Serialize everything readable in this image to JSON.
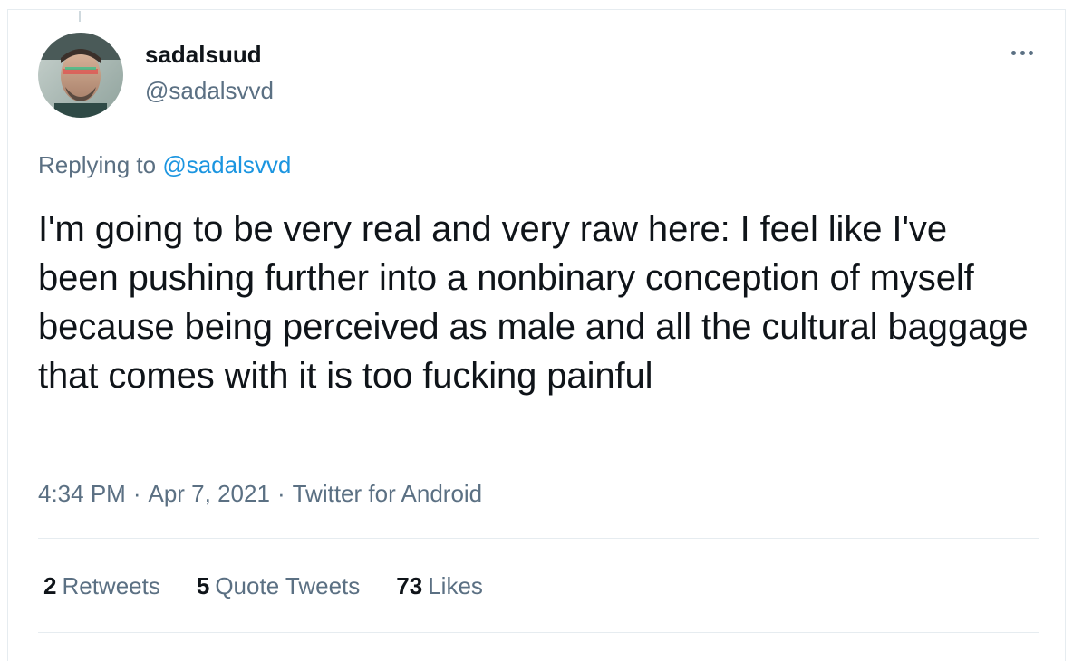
{
  "tweet": {
    "author": {
      "display_name": "sadalsuud",
      "handle": "@sadalsvvd"
    },
    "reply_context": {
      "prefix": "Replying to",
      "mention": "@sadalsvvd"
    },
    "text": "I'm going to be very real and very raw here: I feel like I've been pushing further into a nonbinary conception of myself because being perceived as male and all the cultural baggage that comes with it is too fucking painful",
    "time": "4:34 PM",
    "date": "Apr 7, 2021",
    "source": "Twitter for Android",
    "separator": "·",
    "stats": {
      "retweets": {
        "count": "2",
        "label": "Retweets"
      },
      "quote_tweets": {
        "count": "5",
        "label": "Quote Tweets"
      },
      "likes": {
        "count": "73",
        "label": "Likes"
      }
    }
  },
  "colors": {
    "text_primary": "#0f1419",
    "text_secondary": "#5b7083",
    "link": "#1b95e0",
    "divider": "#e6ecf0"
  },
  "icons": {
    "more": "more-horizontal-icon"
  }
}
